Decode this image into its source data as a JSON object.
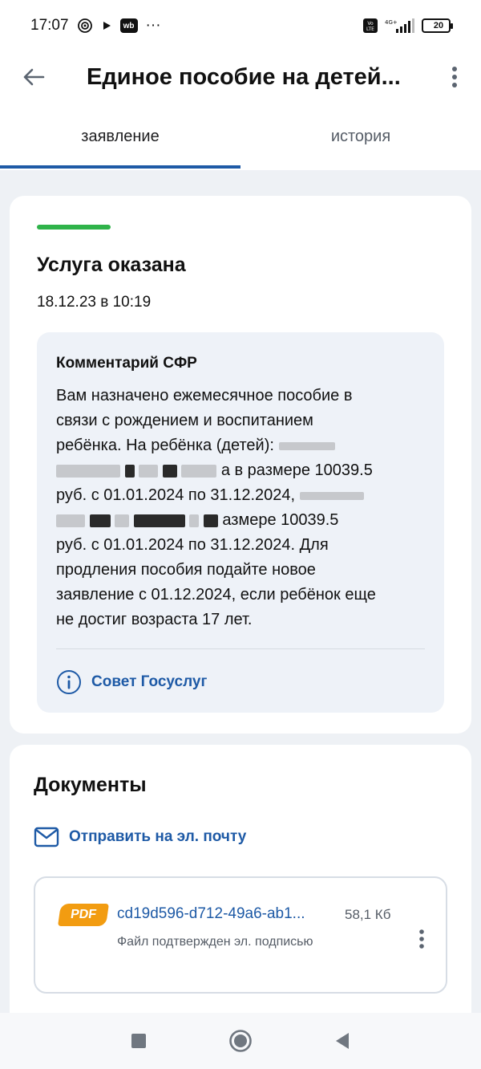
{
  "status_bar": {
    "time": "17:07",
    "wb_label": "wb",
    "more_dots": "···",
    "battery": "20",
    "icons": [
      "hotspot-icon",
      "play-icon",
      "wb-app-icon",
      "volte-icon",
      "signal-icon",
      "battery-icon"
    ]
  },
  "header": {
    "title": "Единое пособие на детей..."
  },
  "tabs": [
    {
      "label": "заявление",
      "active": true
    },
    {
      "label": "история",
      "active": false
    }
  ],
  "status_card": {
    "title": "Услуга оказана",
    "date": "18.12.23 в 10:19",
    "accent_color": "#2fb34a",
    "comment": {
      "title": "Комментарий СФР",
      "line1": "Вам назначено ежемесячное пособие в",
      "line2": "связи с рождением и воспитанием",
      "line3": "ребёнка. На ребёнка (детей):",
      "line4_tail": "а в размере 10039.5",
      "line5": "руб. с 01.01.2024 по 31.12.2024,",
      "line6_tail": "азмере 10039.5",
      "line7": "руб. с 01.01.2024 по 31.12.2024. Для",
      "line8": "продления пособия подайте новое",
      "line9": "заявление с 01.12.2024, если ребёнок еще",
      "line10": "не достиг возраста 17 лет."
    },
    "advice_label": "Совет Госуслуг"
  },
  "documents": {
    "title": "Документы",
    "send_email_label": "Отправить на эл. почту",
    "file": {
      "badge": "PDF",
      "name": "cd19d596-d712-49a6-ab1...",
      "size": "58,1 Кб",
      "signature_note": "Файл подтвержден эл. подписью"
    }
  },
  "colors": {
    "primary": "#1e5aa6",
    "success": "#2fb34a",
    "pdf_badge": "#f29c11"
  }
}
